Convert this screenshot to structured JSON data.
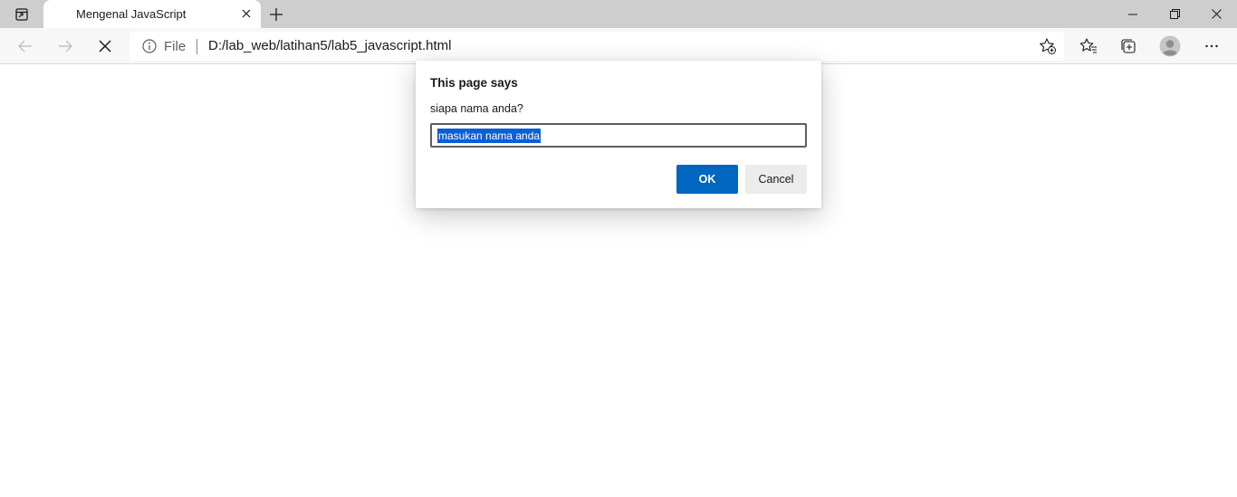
{
  "tabstrip": {
    "tab_title": "Mengenal JavaScript",
    "icons": {
      "tab_actions": "tab-actions-icon",
      "close": "close-icon",
      "new_tab": "plus-icon",
      "minimize": "minimize-icon",
      "restore": "restore-icon",
      "window_close": "close-icon"
    }
  },
  "toolbar": {
    "security_label": "File",
    "url": "D:/lab_web/latihan5/lab5_javascript.html",
    "icons": [
      "back-arrow-icon",
      "forward-arrow-icon",
      "stop-icon",
      "info-icon",
      "add-favorite-icon",
      "favorites-icon",
      "collections-icon",
      "profile-icon",
      "more-icon"
    ]
  },
  "dialog": {
    "title": "This page says",
    "message": "siapa nama anda?",
    "input_value": "masukan nama anda",
    "ok_label": "OK",
    "cancel_label": "Cancel"
  },
  "colors": {
    "accent": "#0067c0",
    "selection": "#0a5fd6",
    "tabstrip_bg": "#cecece",
    "toolbar_bg": "#f7f7f7"
  }
}
